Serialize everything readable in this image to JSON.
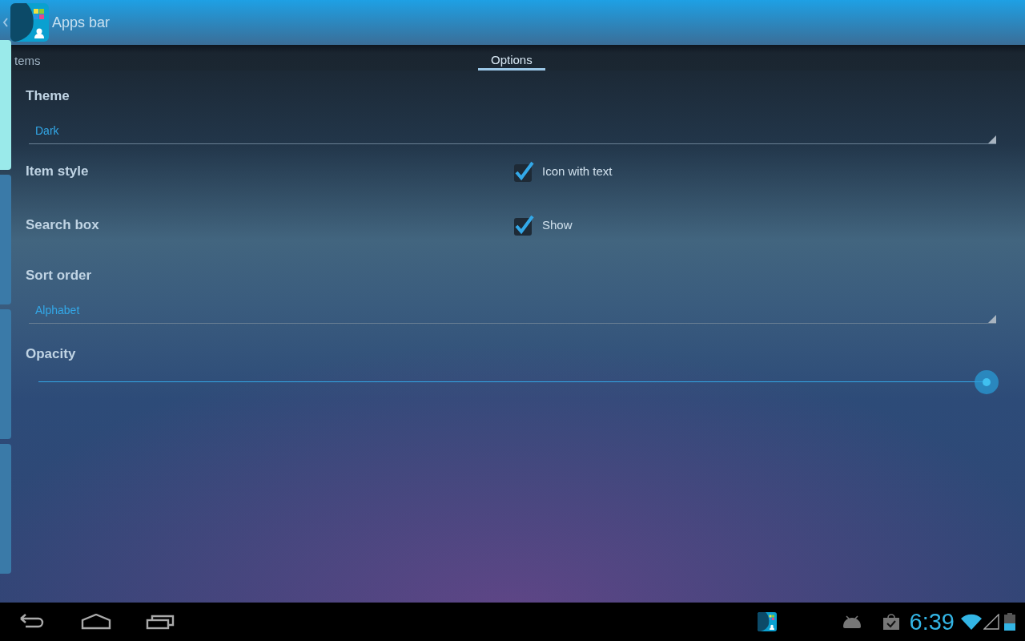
{
  "app_bar": {
    "title": "Apps bar"
  },
  "tabs": [
    {
      "label": "tems",
      "selected": false
    },
    {
      "label": "Options",
      "selected": true
    }
  ],
  "side_handles": [
    {
      "selected": true
    },
    {
      "selected": false
    },
    {
      "selected": false
    },
    {
      "selected": false
    }
  ],
  "options": [
    {
      "kind": "spinner",
      "label": "Theme",
      "value": "Dark"
    },
    {
      "kind": "checkbox",
      "label": "Item style",
      "text": "Icon with text",
      "checked": true
    },
    {
      "kind": "checkbox",
      "label": "Search box",
      "text": "Show",
      "checked": true
    },
    {
      "kind": "spinner",
      "label": "Sort order",
      "value": "Alphabet"
    },
    {
      "kind": "slider",
      "label": "Opacity",
      "level": 1
    }
  ],
  "status_bar": {
    "time": "6:39"
  }
}
